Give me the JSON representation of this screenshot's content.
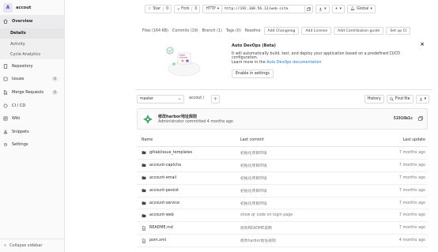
{
  "sidebar": {
    "project_initial": "A",
    "project_name": "accout",
    "items": [
      {
        "label": "Overview"
      },
      {
        "label": "Repository"
      },
      {
        "label": "Issues",
        "count": "0"
      },
      {
        "label": "Merge Requests",
        "count": "0"
      },
      {
        "label": "CI / CD"
      },
      {
        "label": "Wiki"
      },
      {
        "label": "Snippets"
      },
      {
        "label": "Settings"
      }
    ],
    "subitems": [
      {
        "label": "Details"
      },
      {
        "label": "Activity"
      },
      {
        "label": "Cycle Analytics"
      }
    ],
    "collapse_label": "Collapse sidebar"
  },
  "topbar": {
    "star_label": "Star",
    "star_count": "0",
    "fork_label": "Fork",
    "fork_count": "0",
    "protocol_label": "HTTP",
    "clone_url": "http://192.168.56.12/web-site",
    "global_label": "Global"
  },
  "stats": {
    "files": "Files (164 KB)",
    "commits": "Commits (19)",
    "branch": "Branch (1)",
    "tags": "Tags (0)",
    "readme": "Readme",
    "add_changelog": "Add Changelog",
    "add_license": "Add License",
    "add_contribution": "Add Contribution guide",
    "setup_ci": "Set up CI"
  },
  "autodevops": {
    "title": "Auto DevOps (Beta)",
    "text": "It will automatically build, test, and deploy your application based on a predefined CI/CD configuration.",
    "learn_prefix": "Learn more in the ",
    "learn_link": "Auto DevOps documentation",
    "enable_label": "Enable in settings",
    "close": "×"
  },
  "branchbar": {
    "branch": "master",
    "path": "accout",
    "path_sep": "/",
    "history_label": "History",
    "find_file_label": "Find file"
  },
  "last_commit": {
    "title": "修改harbor地址规则",
    "meta": "Administrator committed 4 months ago",
    "sha": "51916b1c"
  },
  "tree": {
    "headers": {
      "name": "Name",
      "commit": "Last commit",
      "update": "Last update"
    },
    "rows": [
      {
        "type": "folder",
        "name": "gitlab/issue_templates",
        "commit": "初始化项目环境",
        "update": "7 months ago"
      },
      {
        "type": "folder",
        "name": "account-captcha",
        "commit": "初始化项目环境",
        "update": "7 months ago"
      },
      {
        "type": "folder",
        "name": "account-email",
        "commit": "初始化项目环境",
        "update": "7 months ago"
      },
      {
        "type": "folder",
        "name": "account-persist",
        "commit": "初始化项目环境",
        "update": "7 months ago"
      },
      {
        "type": "folder",
        "name": "account-service",
        "commit": "初始化项目环境",
        "update": "7 months ago"
      },
      {
        "type": "folder",
        "name": "account-web",
        "commit": "show qr code on login page",
        "update": "7 months ago"
      },
      {
        "type": "file",
        "name": "README.md",
        "commit": "修改README说明",
        "update": "7 months ago"
      },
      {
        "type": "file",
        "name": "pom.xml",
        "commit": "修改harbor地址规则",
        "update": "4 months ago"
      }
    ]
  }
}
